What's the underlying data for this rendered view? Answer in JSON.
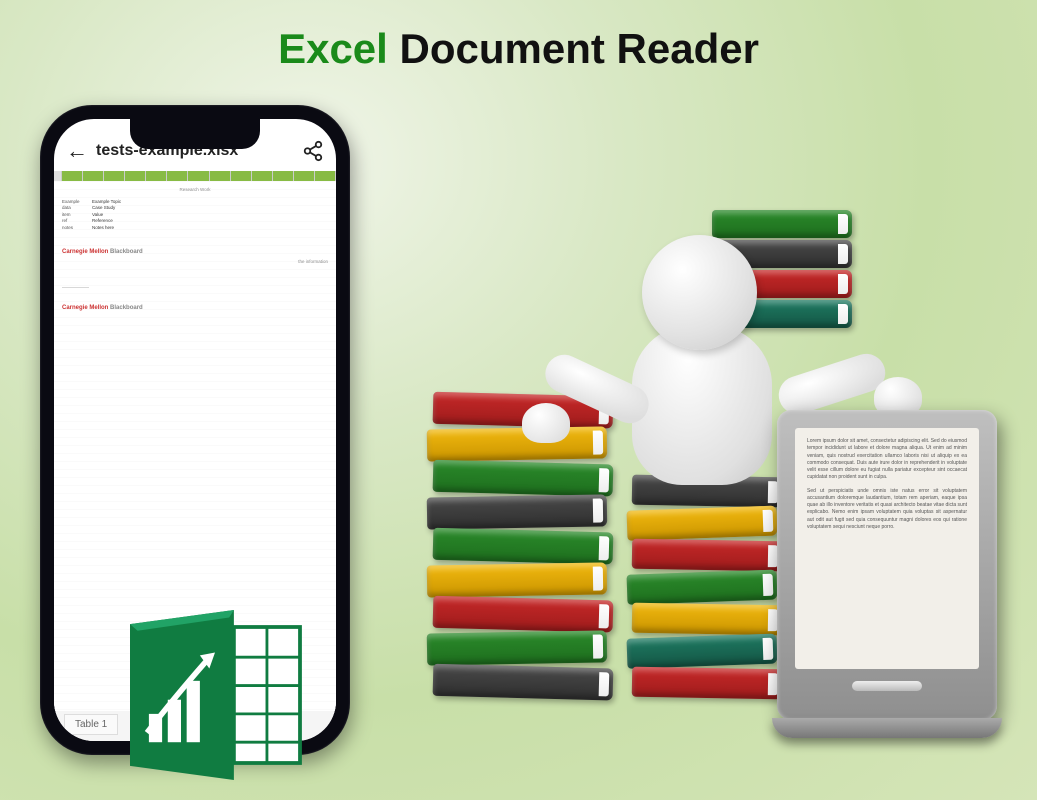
{
  "title": {
    "word1": "Excel",
    "word2": "Document Reader"
  },
  "phone": {
    "filename": "tests-example.xlsx",
    "tab": "Table 1",
    "content": {
      "heading": "Research Work",
      "rows": [
        {
          "k": "Example",
          "v": "Example Topic"
        },
        {
          "k": "data",
          "v": "Case Study"
        },
        {
          "k": "item",
          "v": "Value"
        },
        {
          "k": "ref",
          "v": "Reference"
        },
        {
          "k": "notes",
          "v": "Notes here"
        }
      ],
      "brand1": "Carnegie Mellon",
      "brand1b": "Blackboard",
      "brand2": "Carnegie Mellon",
      "brand2b": "Blackboard",
      "footer": "the information"
    }
  },
  "tablet": {
    "para1": "Lorem ipsum dolor sit amet, consectetur adipiscing elit. Sed do eiusmod tempor incididunt ut labore et dolore magna aliqua. Ut enim ad minim veniam, quis nostrud exercitation ullamco laboris nisi ut aliquip ex ea commodo consequat. Duis aute irure dolor in reprehenderit in voluptate velit esse cillum dolore eu fugiat nulla pariatur excepteur sint occaecat cupidatat non proident sunt in culpa.",
    "para2": "Sed ut perspiciatis unde omnis iste natus error sit voluptatem accusantium doloremque laudantium, totam rem aperiam, eaque ipsa quae ab illo inventore veritatis et quasi architecto beatae vitae dicta sunt explicabo. Nemo enim ipsam voluptatem quia voluptas sit aspernatur aut odit aut fugit sed quia consequuntur magni dolores eos qui ratione voluptatem sequi nesciunt neque porro."
  }
}
